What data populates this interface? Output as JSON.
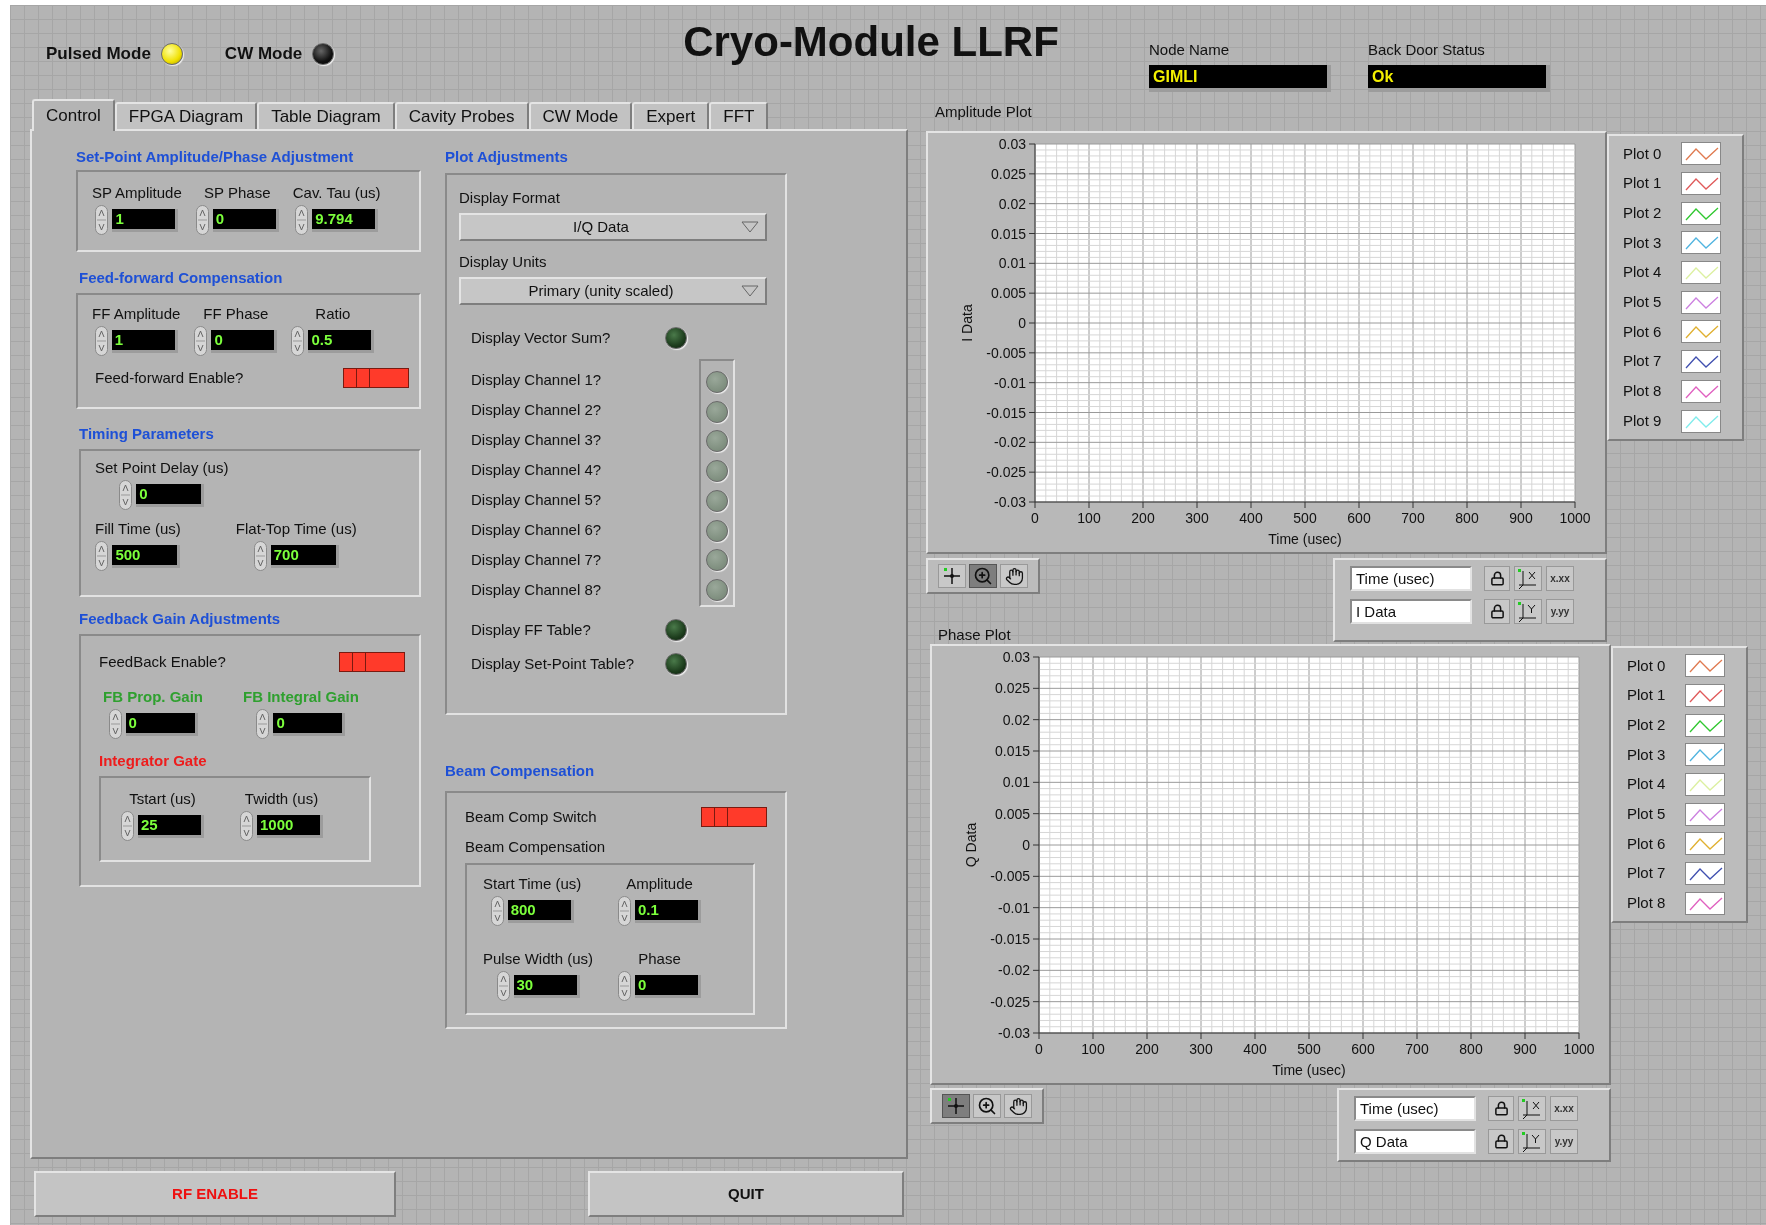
{
  "header": {
    "title": "Cryo-Module LLRF",
    "indicators": [
      {
        "label": "Pulsed Mode",
        "on": true
      },
      {
        "label": "CW Mode",
        "on": false
      }
    ],
    "status_fields": [
      {
        "label": "Node Name",
        "value": "GIMLI"
      },
      {
        "label": "Back Door Status",
        "value": "Ok"
      }
    ]
  },
  "tabs": [
    {
      "label": "Control",
      "selected": true
    },
    {
      "label": "FPGA Diagram",
      "selected": false
    },
    {
      "label": "Table Diagram",
      "selected": false
    },
    {
      "label": "Cavity Probes",
      "selected": false
    },
    {
      "label": "CW Mode",
      "selected": false
    },
    {
      "label": "Expert",
      "selected": false
    },
    {
      "label": "FFT",
      "selected": false
    }
  ],
  "control_tab": {
    "setpoint": {
      "heading": "Set-Point Amplitude/Phase Adjustment",
      "controls": [
        {
          "label": "SP Amplitude",
          "value": "1"
        },
        {
          "label": "SP Phase",
          "value": "0"
        },
        {
          "label": "Cav. Tau (us)",
          "value": "9.794"
        }
      ]
    },
    "feed_forward": {
      "heading": "Feed-forward Compensation",
      "controls": [
        {
          "label": "FF Amplitude",
          "value": "1"
        },
        {
          "label": "FF Phase",
          "value": "0"
        },
        {
          "label": "Ratio",
          "value": "0.5"
        }
      ],
      "switch": {
        "label": "Feed-forward Enable?",
        "on": false
      }
    },
    "timing": {
      "heading": "Timing Parameters",
      "controls": [
        {
          "label": "Set Point Delay (us)",
          "value": "0"
        },
        {
          "label": "Fill Time (us)",
          "value": "500"
        },
        {
          "label": "Flat-Top Time (us)",
          "value": "700"
        }
      ]
    },
    "feedback": {
      "heading": "Feedback Gain Adjustments",
      "switch": {
        "label": "FeedBack Enable?",
        "on": false
      },
      "gains": [
        {
          "label": "FB Prop. Gain",
          "value": "0"
        },
        {
          "label": "FB Integral Gain",
          "value": "0"
        }
      ],
      "integrator_gate": {
        "heading": "Integrator Gate",
        "controls": [
          {
            "label": "Tstart (us)",
            "value": "25"
          },
          {
            "label": "Twidth (us)",
            "value": "1000"
          }
        ]
      }
    },
    "plot_adjustments": {
      "heading": "Plot Adjustments",
      "dropdowns": [
        {
          "label": "Display Format",
          "value": "I/Q Data"
        },
        {
          "label": "Display Units",
          "value": "Primary (unity scaled)"
        }
      ],
      "vector_sum": {
        "label": "Display Vector Sum?",
        "on": false
      },
      "channels": [
        {
          "label": "Display Channel 1?",
          "on": false,
          "disabled": true
        },
        {
          "label": "Display Channel 2?",
          "on": false,
          "disabled": true
        },
        {
          "label": "Display Channel 3?",
          "on": false,
          "disabled": true
        },
        {
          "label": "Display Channel 4?",
          "on": false,
          "disabled": true
        },
        {
          "label": "Display Channel 5?",
          "on": false,
          "disabled": true
        },
        {
          "label": "Display Channel 6?",
          "on": false,
          "disabled": true
        },
        {
          "label": "Display Channel 7?",
          "on": false,
          "disabled": true
        },
        {
          "label": "Display Channel 8?",
          "on": false,
          "disabled": true
        }
      ],
      "tables": [
        {
          "label": "Display FF Table?",
          "on": false
        },
        {
          "label": "Display Set-Point Table?",
          "on": false
        }
      ]
    },
    "beam": {
      "heading": "Beam Compensation",
      "switch": {
        "label": "Beam Comp Switch",
        "on": false
      },
      "group_label": "Beam Compensation",
      "controls": [
        {
          "label": "Start Time (us)",
          "value": "800"
        },
        {
          "label": "Amplitude",
          "value": "0.1"
        },
        {
          "label": "Pulse Width (us)",
          "value": "30"
        },
        {
          "label": "Phase",
          "value": "0"
        }
      ]
    }
  },
  "buttons": [
    {
      "label": "RF ENABLE",
      "kind": "alert"
    },
    {
      "label": "QUIT",
      "kind": "normal"
    }
  ],
  "plots": [
    {
      "label": "Amplitude Plot",
      "chart_data": {
        "type": "line",
        "grid": true,
        "xlabel": "Time (usec)",
        "ylabel": "I Data",
        "xlim": [
          0,
          1000
        ],
        "ylim": [
          -0.03,
          0.03
        ],
        "xticks": [
          0,
          100,
          200,
          300,
          400,
          500,
          600,
          700,
          800,
          900,
          1000
        ],
        "yticks": [
          0.03,
          0.025,
          0.02,
          0.015,
          0.01,
          0.005,
          0,
          -0.005,
          -0.01,
          -0.015,
          -0.02,
          -0.025,
          -0.03
        ]
      },
      "legend": [
        {
          "name": "Plot 0",
          "color": "#e07a50"
        },
        {
          "name": "Plot 1",
          "color": "#e05a5a"
        },
        {
          "name": "Plot 2",
          "color": "#30c830"
        },
        {
          "name": "Plot 3",
          "color": "#50b4e0"
        },
        {
          "name": "Plot 4",
          "color": "#dcf0a0"
        },
        {
          "name": "Plot 5",
          "color": "#cc80e0"
        },
        {
          "name": "Plot 6",
          "color": "#e0b030"
        },
        {
          "name": "Plot 7",
          "color": "#4050b0"
        },
        {
          "name": "Plot 8",
          "color": "#e060c0"
        },
        {
          "name": "Plot 9",
          "color": "#80ecec"
        }
      ],
      "tools": [
        {
          "kind": "cursor",
          "selected": false
        },
        {
          "kind": "zoom",
          "selected": true
        },
        {
          "kind": "pan",
          "selected": false
        }
      ],
      "scales": [
        {
          "value": "Time (usec)",
          "kind": "x",
          "format": "x.xx"
        },
        {
          "value": "I Data",
          "kind": "y",
          "format": "y.yy"
        }
      ]
    },
    {
      "label": "Phase Plot",
      "chart_data": {
        "type": "line",
        "grid": true,
        "xlabel": "Time (usec)",
        "ylabel": "Q Data",
        "xlim": [
          0,
          1000
        ],
        "ylim": [
          -0.03,
          0.03
        ],
        "xticks": [
          0,
          100,
          200,
          300,
          400,
          500,
          600,
          700,
          800,
          900,
          1000
        ],
        "yticks": [
          0.03,
          0.025,
          0.02,
          0.015,
          0.01,
          0.005,
          0,
          -0.005,
          -0.01,
          -0.015,
          -0.02,
          -0.025,
          -0.03
        ]
      },
      "legend": [
        {
          "name": "Plot 0",
          "color": "#e07a50"
        },
        {
          "name": "Plot 1",
          "color": "#e05a5a"
        },
        {
          "name": "Plot 2",
          "color": "#30c830"
        },
        {
          "name": "Plot 3",
          "color": "#50b4e0"
        },
        {
          "name": "Plot 4",
          "color": "#dcf0a0"
        },
        {
          "name": "Plot 5",
          "color": "#cc80e0"
        },
        {
          "name": "Plot 6",
          "color": "#e0b030"
        },
        {
          "name": "Plot 7",
          "color": "#4050b0"
        },
        {
          "name": "Plot 8",
          "color": "#e060c0"
        }
      ],
      "tools": [
        {
          "kind": "cursor",
          "selected": true
        },
        {
          "kind": "zoom",
          "selected": false
        },
        {
          "kind": "pan",
          "selected": false
        }
      ],
      "scales": [
        {
          "value": "Time (usec)",
          "kind": "x",
          "format": "x.xx"
        },
        {
          "value": "Q Data",
          "kind": "y",
          "format": "y.yy"
        }
      ]
    }
  ]
}
